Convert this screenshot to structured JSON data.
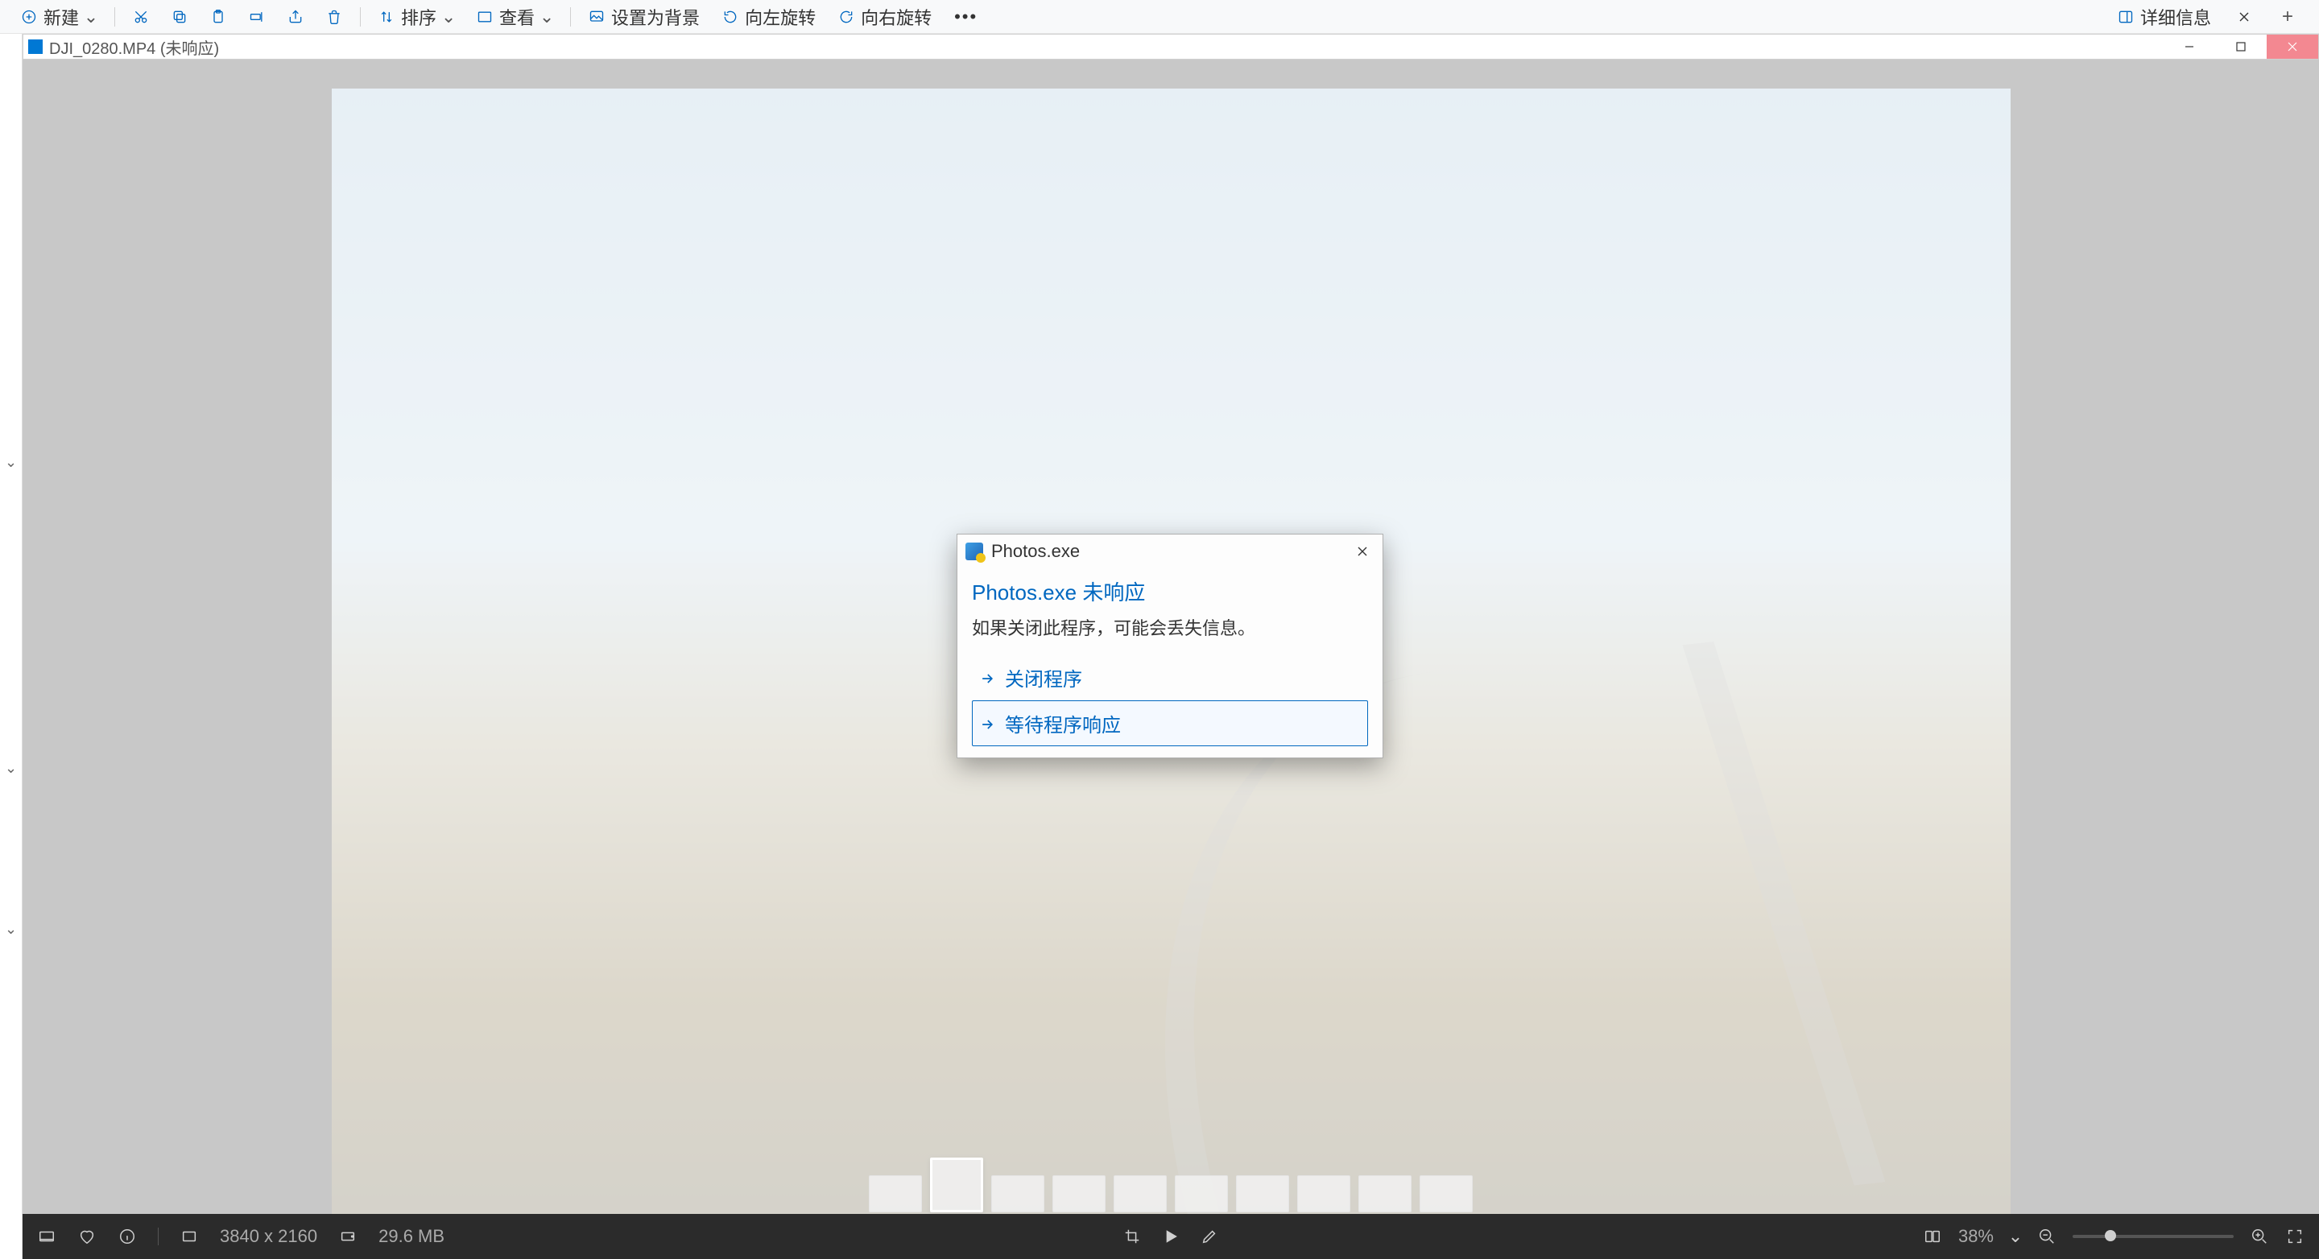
{
  "toolbar": {
    "new_label": "新建",
    "sort_label": "排序",
    "view_label": "查看",
    "set_background": "设置为背景",
    "rotate_left": "向左旋转",
    "rotate_right": "向右旋转",
    "details": "详细信息"
  },
  "child_window": {
    "title": "DJI_0280.MP4 (未响应)"
  },
  "status": {
    "dimensions": "3840 x 2160",
    "filesize": "29.6 MB",
    "zoom_percent": "38%"
  },
  "modal": {
    "process_name": "Photos.exe",
    "title": "Photos.exe 未响应",
    "message": "如果关闭此程序，可能会丢失信息。",
    "option_close": "关闭程序",
    "option_wait": "等待程序响应"
  }
}
